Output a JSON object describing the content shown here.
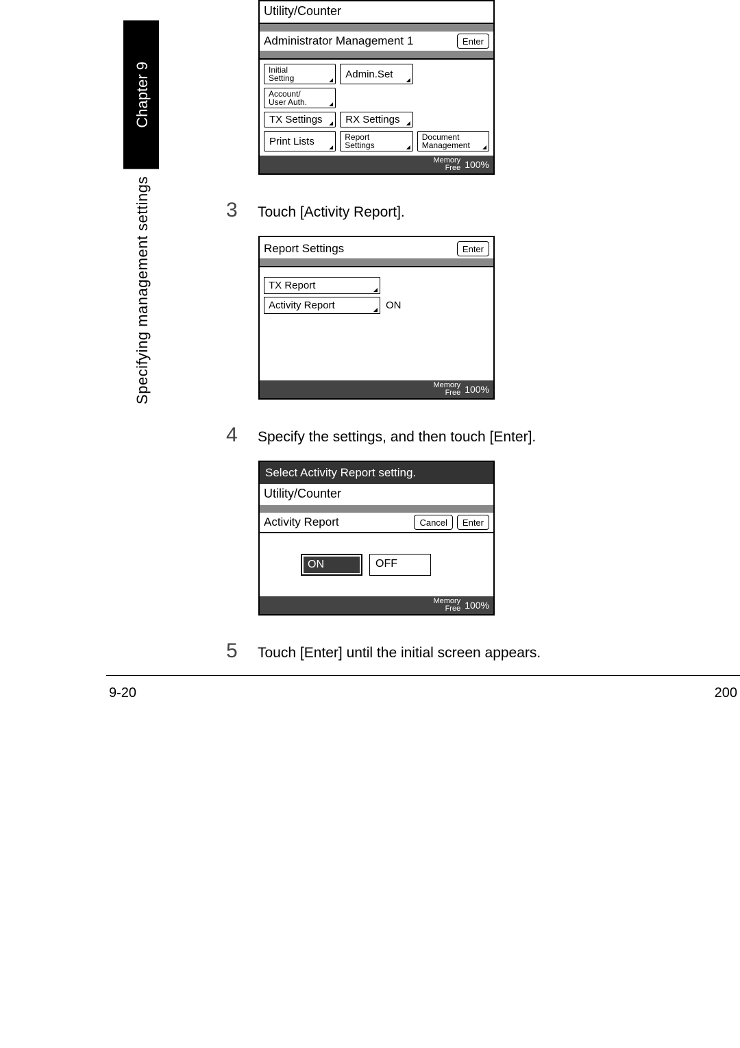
{
  "side": {
    "chapter": "Chapter 9",
    "section": "Specifying management settings"
  },
  "screen1": {
    "title": "Utility/Counter",
    "header": "Administrator Management 1",
    "enter": "Enter",
    "btns": {
      "initial1": "Initial",
      "initial2": "Setting",
      "adminset": "Admin.Set",
      "acct1": "Account/",
      "acct2": "User Auth.",
      "tx": "TX Settings",
      "rx": "RX Settings",
      "print": "Print Lists",
      "rep1": "Report",
      "rep2": "Settings",
      "doc1": "Document",
      "doc2": "Management"
    },
    "mem1": "Memory",
    "mem2": "Free",
    "pct": "100%"
  },
  "step3": {
    "num": "3",
    "text": "Touch [Activity Report]."
  },
  "screen2": {
    "title": "Report Settings",
    "enter": "Enter",
    "txreport": "TX Report",
    "activity": "Activity Report",
    "on": "ON",
    "mem1": "Memory",
    "mem2": "Free",
    "pct": "100%"
  },
  "step4": {
    "num": "4",
    "text": "Specify the settings, and then touch [Enter]."
  },
  "screen3": {
    "instr": "Select Activity Report setting.",
    "title": "Utility/Counter",
    "header": "Activity Report",
    "cancel": "Cancel",
    "enter": "Enter",
    "on": "ON",
    "off": "OFF",
    "mem1": "Memory",
    "mem2": "Free",
    "pct": "100%"
  },
  "step5": {
    "num": "5",
    "text": "Touch [Enter] until the initial screen appears."
  },
  "footer": {
    "left": "9-20",
    "right": "200"
  }
}
